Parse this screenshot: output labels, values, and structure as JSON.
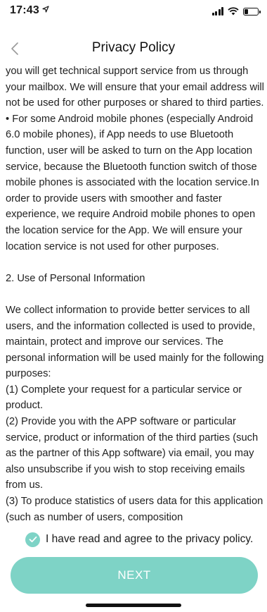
{
  "status_bar": {
    "time": "17:43",
    "battery_level": 0.3
  },
  "nav": {
    "title": "Privacy Policy",
    "back_icon": "chevron-left-icon"
  },
  "policy": {
    "paragraphs": [
      "you will get technical support service from us through your mailbox. We will ensure that your email address will not be used for other purposes or shared to third parties.\n• For some Android mobile phones (especially Android 6.0 mobile phones), if App needs to use Bluetooth function, user will be asked to turn on the App location service, because the Bluetooth function switch of those mobile phones is associated with the location service.In order to provide users with smoother and faster experience, we require Android mobile phones to open the location service for the App. We will ensure your location service is not used for other purposes.",
      "2. Use of Personal Information",
      "We collect information to provide better services to all users, and the information collected is used to provide, maintain, protect and improve our services. The personal information will be used mainly for the following purposes:\n(1) Complete your request for a particular service or product.\n(2) Provide you with the APP software or particular service, product or information of the third parties (such as the partner of this App software) via email, you may also unsubscribe if you wish to stop receiving emails from us.\n(3) To produce statistics of users data for this application (such as number of users, composition"
    ]
  },
  "agreement": {
    "label": "I have read and agree to the privacy policy.",
    "checked": true
  },
  "next_button": {
    "label": "NEXT"
  },
  "colors": {
    "accent": "#7ed3c6"
  }
}
